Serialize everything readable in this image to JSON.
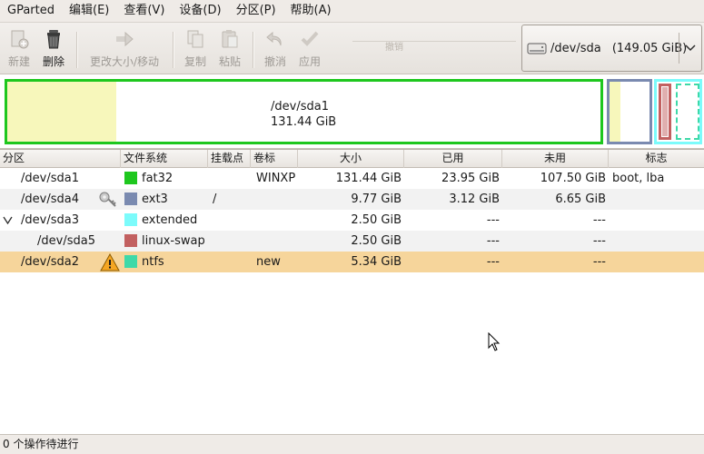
{
  "menubar": {
    "items": [
      "GParted",
      "编辑(E)",
      "查看(V)",
      "设备(D)",
      "分区(P)",
      "帮助(A)"
    ]
  },
  "toolbar": {
    "new": "新建",
    "delete": "删除",
    "resize_move": "更改大小/移动",
    "copy": "复制",
    "paste": "粘贴",
    "undo": "撤消",
    "apply": "应用",
    "ghost_label": "撤销"
  },
  "device": {
    "path": "/dev/sda",
    "size": "(149.05 GiB)"
  },
  "disk_map": {
    "selected_name": "/dev/sda1",
    "selected_size": "131.44 GiB"
  },
  "table": {
    "columns": [
      "分区",
      "文件系统",
      "挂载点",
      "卷标",
      "大小",
      "已用",
      "未用",
      "标志"
    ],
    "rows": [
      {
        "partition": "/dev/sda1",
        "fs": "fat32",
        "fs_color": "#1ec71e",
        "mount": "",
        "label": "WINXP",
        "size": "131.44 GiB",
        "used": "23.95 GiB",
        "unused": "107.50 GiB",
        "flags": "boot, lba"
      },
      {
        "partition": "/dev/sda4",
        "fs": "ext3",
        "fs_color": "#7a8ab0",
        "mount": "/",
        "label": "",
        "size": "9.77 GiB",
        "used": "3.12 GiB",
        "unused": "6.65 GiB",
        "flags": ""
      },
      {
        "partition": "/dev/sda3",
        "fs": "extended",
        "fs_color": "#7cfbfb",
        "mount": "",
        "label": "",
        "size": "2.50 GiB",
        "used": "---",
        "unused": "---",
        "flags": ""
      },
      {
        "partition": "/dev/sda5",
        "fs": "linux-swap",
        "fs_color": "#c26060",
        "mount": "",
        "label": "",
        "size": "2.50 GiB",
        "used": "---",
        "unused": "---",
        "flags": ""
      },
      {
        "partition": "/dev/sda2",
        "fs": "ntfs",
        "fs_color": "#3ed9a8",
        "mount": "",
        "label": "new",
        "size": "5.34 GiB",
        "used": "---",
        "unused": "---",
        "flags": ""
      }
    ]
  },
  "statusbar": {
    "text": "0 个操作待进行"
  },
  "icons": {
    "new": "new-partition-icon",
    "delete": "trash-icon",
    "resize": "resize-move-icon",
    "copy": "copy-icon",
    "paste": "paste-icon",
    "undo": "undo-icon",
    "apply": "apply-checkmark-icon",
    "drive": "hard-drive-icon",
    "mount": "key-icon",
    "warning": "warning-icon"
  }
}
